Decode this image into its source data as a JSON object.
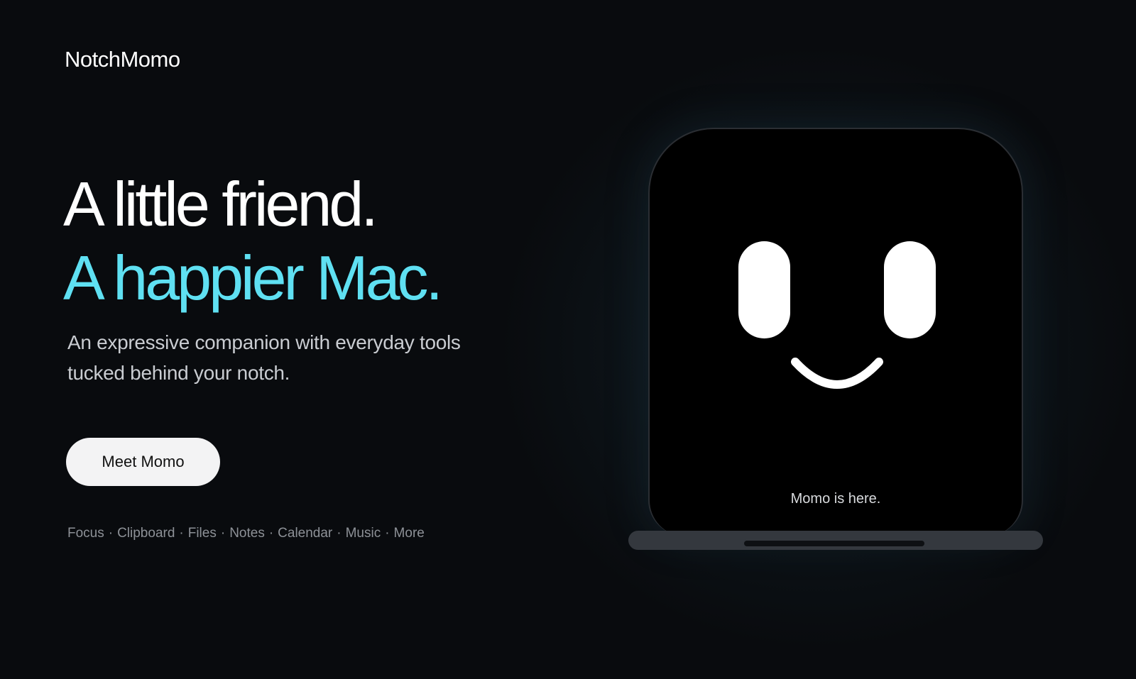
{
  "brand": "NotchMomo",
  "headline": {
    "line1": "A little friend.",
    "line2": "A happier Mac."
  },
  "subtitle": {
    "line1": "An expressive companion with everyday tools",
    "line2": "tucked behind your notch."
  },
  "cta": {
    "label": "Meet Momo"
  },
  "features": {
    "separator": "·",
    "items": [
      "Focus",
      "Clipboard",
      "Files",
      "Notes",
      "Calendar",
      "Music",
      "More"
    ]
  },
  "device": {
    "status_text": "Momo is here."
  },
  "colors": {
    "background": "#090b0e",
    "accent": "#5fe0f2",
    "button_bg": "#f3f3f4",
    "muted_text": "#8d9197"
  }
}
